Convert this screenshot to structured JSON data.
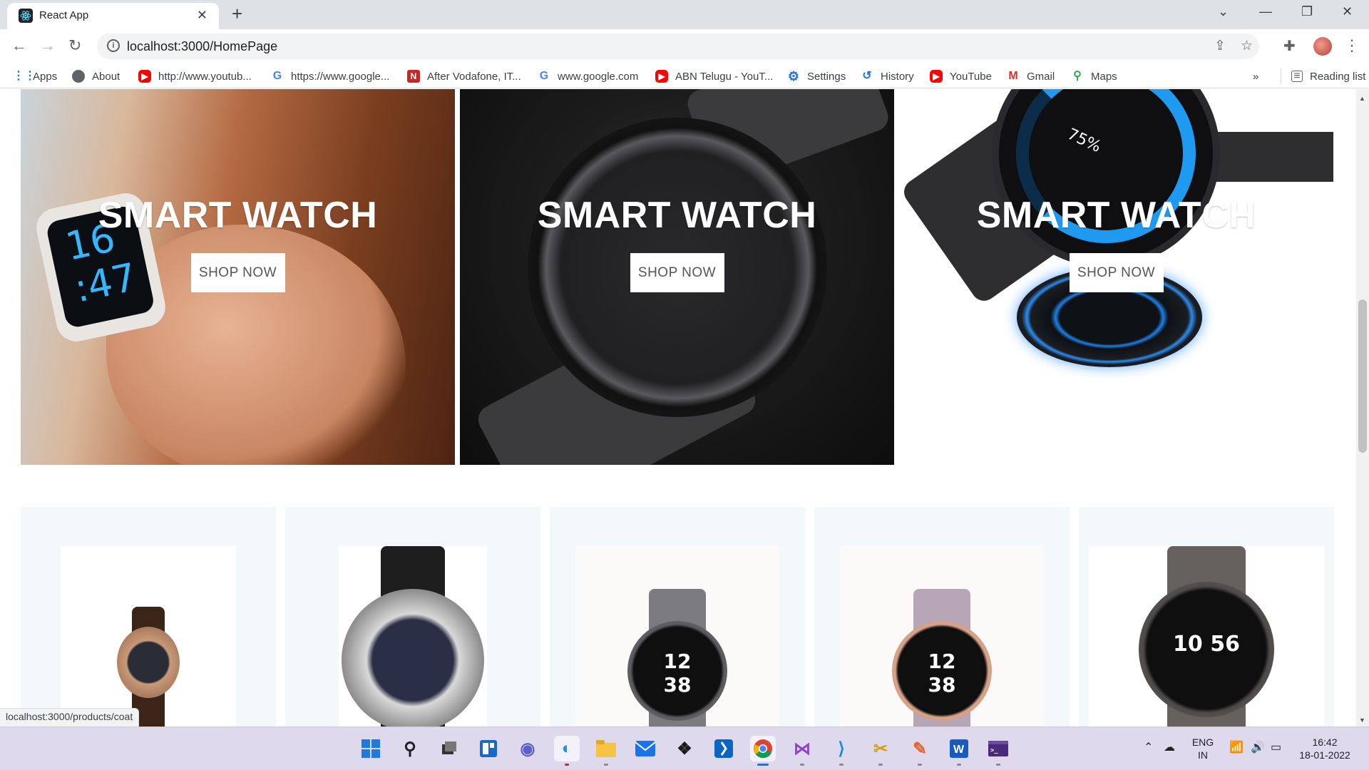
{
  "browser": {
    "tab_title": "React App",
    "url": "localhost:3000/HomePage",
    "status_url": "localhost:3000/products/coat"
  },
  "bookmarks": {
    "items": [
      {
        "label": "Apps",
        "icon": "apps-grid-icon"
      },
      {
        "label": "About",
        "icon": "globe-icon"
      },
      {
        "label": "http://www.youtub...",
        "icon": "youtube-icon"
      },
      {
        "label": "https://www.google...",
        "icon": "google-icon"
      },
      {
        "label": "After Vodafone, IT...",
        "icon": "news-icon"
      },
      {
        "label": "www.google.com",
        "icon": "google-icon"
      },
      {
        "label": "ABN Telugu - YouT...",
        "icon": "youtube-icon"
      },
      {
        "label": "Settings",
        "icon": "gear-icon"
      },
      {
        "label": "History",
        "icon": "history-icon"
      },
      {
        "label": "YouTube",
        "icon": "youtube-icon"
      },
      {
        "label": "Gmail",
        "icon": "gmail-icon"
      },
      {
        "label": "Maps",
        "icon": "maps-pin-icon"
      }
    ],
    "overflow": "»",
    "reading_list": "Reading list"
  },
  "banners": [
    {
      "title": "SMART WATCH",
      "button": "SHOP NOW",
      "screen_time": "16\n:47"
    },
    {
      "title": "SMART WATCH",
      "button": "SHOP NOW"
    },
    {
      "title": "SMART WATCH",
      "button": "SHOP NOW",
      "battery": "75%"
    }
  ],
  "products": [
    {
      "dial": ""
    },
    {
      "dial": ""
    },
    {
      "dial": "12 38"
    },
    {
      "dial": "12 38"
    },
    {
      "dial": "10 56"
    }
  ],
  "taskbar": {
    "lang_top": "ENG",
    "lang_bottom": "IN",
    "time": "16:42",
    "date": "18-01-2022"
  },
  "colors": {
    "taskbar": "#dfd9ee",
    "tab_strip": "#dee1e6",
    "card_bg": "#f3f8fb",
    "charger_glow": "#1e9bf0"
  }
}
